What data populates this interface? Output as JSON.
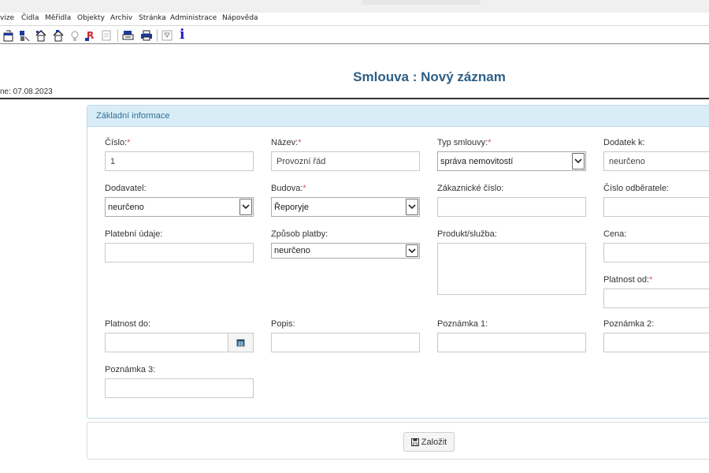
{
  "menu": [
    "vize",
    "Čidla",
    "Měřidla",
    "Objekty",
    "Archiv",
    "Stránka",
    "Administrace",
    "Nápověda"
  ],
  "toolbar": {
    "icons": [
      "new-window-icon",
      "person-icon",
      "house-icon",
      "house-outline-icon",
      "settings-icon",
      "report-r-icon",
      "document-icon",
      "export-icon",
      "print-icon",
      "filter-icon",
      "info-icon"
    ],
    "info_glyph": "i"
  },
  "page": {
    "title": "Smlouva : Nový záznam",
    "date_text": "ne: 07.08.2023"
  },
  "panel": {
    "heading": "Základní informace"
  },
  "form": {
    "cislo": {
      "label": "Číslo:",
      "required": "*",
      "value": "1"
    },
    "nazev": {
      "label": "Název:",
      "required": "*",
      "value": "Provozní řád"
    },
    "typ_smlouvy": {
      "label": "Typ smlouvy:",
      "required": "*",
      "value": "správa nemovitostí"
    },
    "dodatek": {
      "label": "Dodatek k:",
      "value": "neurčeno"
    },
    "dodavatel": {
      "label": "Dodavatel:",
      "value": "neurčeno"
    },
    "budova": {
      "label": "Budova:",
      "required": "*",
      "value": "Řeporyje"
    },
    "zakaznicke_cislo": {
      "label": "Zákaznické číslo:",
      "value": ""
    },
    "cislo_odberatele": {
      "label": "Číslo odběratele:",
      "value": ""
    },
    "platebni_udaje": {
      "label": "Platební údaje:",
      "value": ""
    },
    "zpusob_platby": {
      "label": "Způsob platby:",
      "value": "neurčeno"
    },
    "produkt_sluzba": {
      "label": "Produkt/služba:",
      "value": ""
    },
    "cena": {
      "label": "Cena:",
      "value": ""
    },
    "platnost_od": {
      "label": "Platnost od:",
      "required": "*",
      "value": ""
    },
    "platnost_do": {
      "label": "Platnost do:",
      "value": ""
    },
    "popis": {
      "label": "Popis:",
      "value": ""
    },
    "poznamka1": {
      "label": "Poznámka 1:",
      "value": ""
    },
    "poznamka2": {
      "label": "Poznámka 2:",
      "value": ""
    },
    "poznamka3": {
      "label": "Poznámka 3:",
      "value": ""
    }
  },
  "actions": {
    "create_label": "Založit"
  },
  "colors": {
    "title": "#2d5f86",
    "panel_header_bg": "#d9edf7",
    "panel_header_text": "#31708f",
    "required": "#d9534f",
    "info_icon": "#1a1ad0"
  }
}
